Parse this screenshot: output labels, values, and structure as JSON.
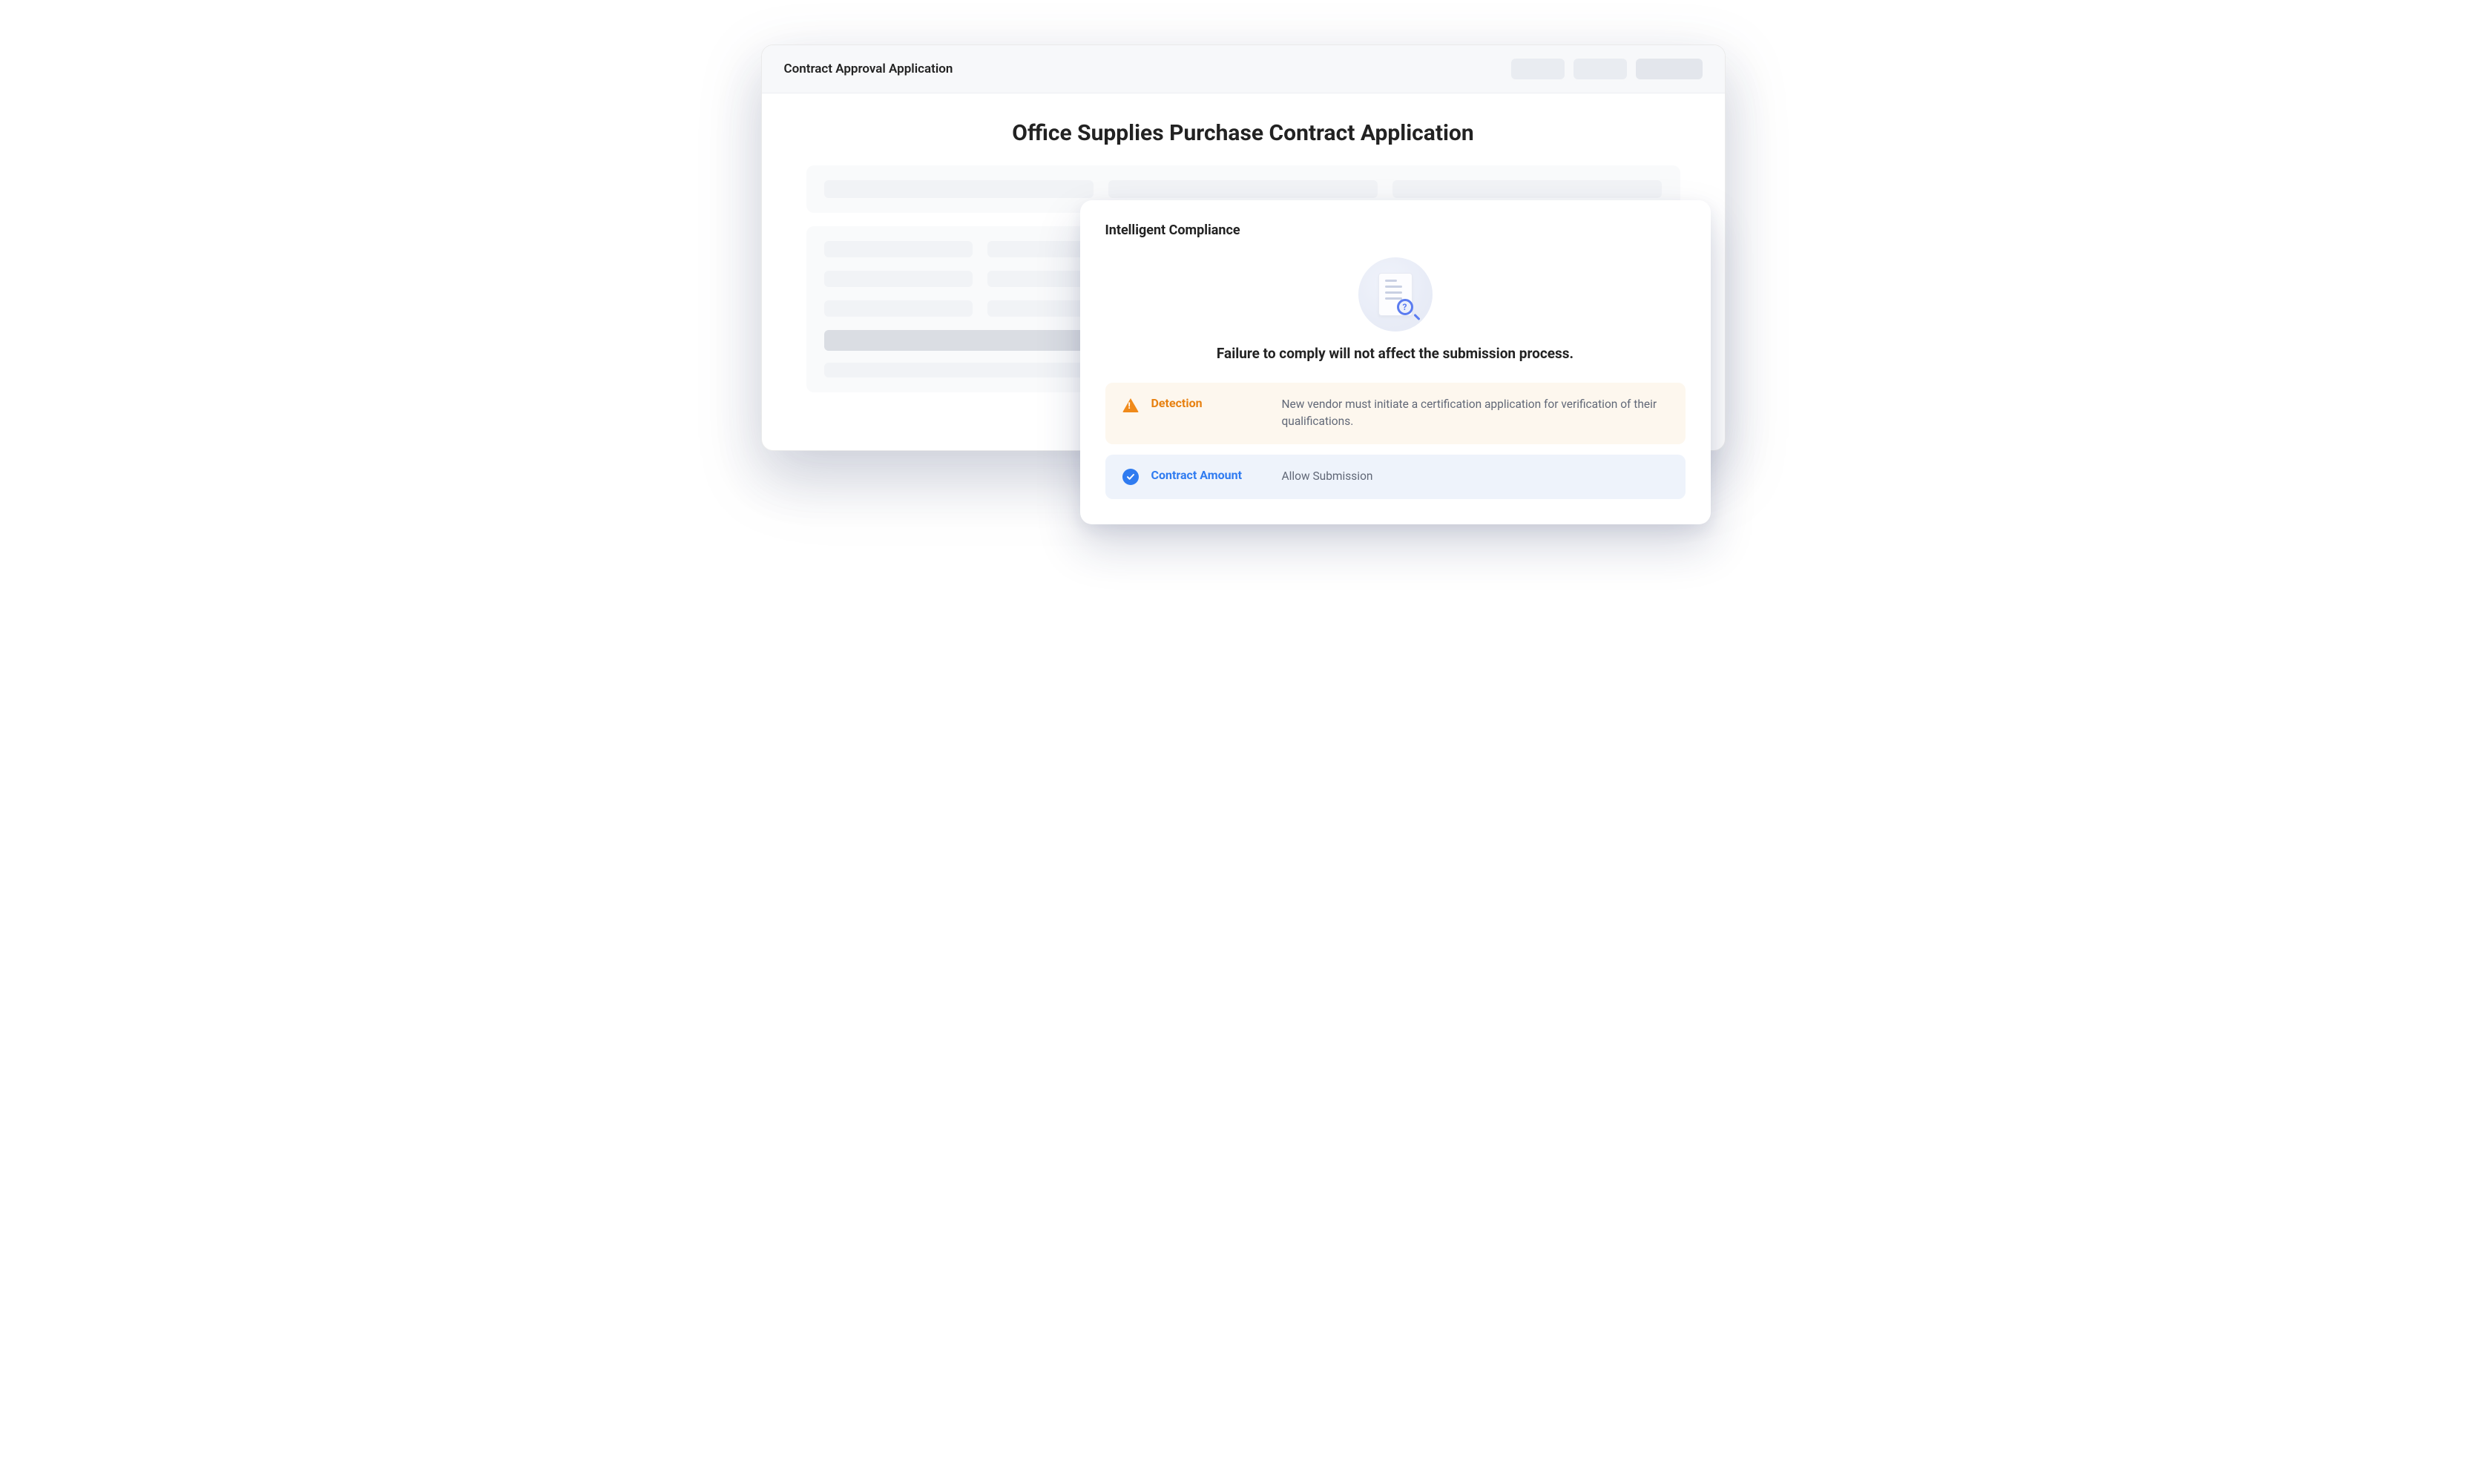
{
  "header": {
    "title": "Contract Approval Application"
  },
  "main": {
    "page_title": "Office Supplies Purchase Contract Application"
  },
  "compliance": {
    "title": "Intelligent Compliance",
    "message": "Failure to comply will not affect the submission process.",
    "results": [
      {
        "status": "warning",
        "label": "Detection",
        "text": "New vendor must initiate a certification application for verification of their qualifications."
      },
      {
        "status": "ok",
        "label": "Contract Amount",
        "text": "Allow Submission"
      }
    ]
  }
}
